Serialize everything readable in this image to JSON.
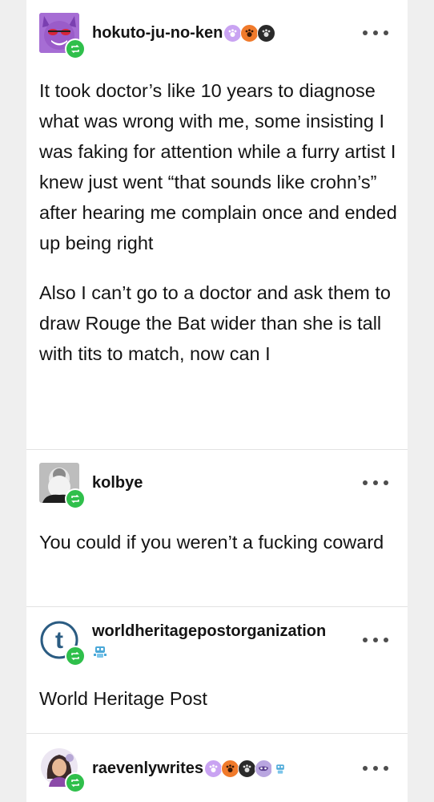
{
  "posts": [
    {
      "username": "hokuto-ju-no-ken",
      "badges": [
        "paw-badge-purple",
        "paw-badge-orange",
        "paw-badge-dark"
      ],
      "paragraphs": [
        "It took doctor’s like 10 years to diagnose what was wrong with me, some insisting I was faking for attention while a furry artist I knew just went “that sounds like crohn’s” after hearing me complain once and ended up being right",
        "Also I can’t go to a doctor and ask them to draw Rouge the Bat wider than she is tall with tits to match, now can I"
      ]
    },
    {
      "username": "kolbye",
      "badges": [],
      "paragraphs": [
        "You could if you weren’t a fucking coward"
      ]
    },
    {
      "username": "worldheritagepostorganization",
      "badges": [
        "robot-badge"
      ],
      "paragraphs": [
        "World Heritage Post"
      ]
    },
    {
      "username": "raevenlywrites",
      "badges": [
        "paw-badge-purple",
        "paw-badge-orange",
        "paw-badge-dark",
        "mask-badge",
        "robot-badge"
      ],
      "paragraphs": []
    }
  ],
  "colors": {
    "reblog_badge": "#2fbf4b",
    "tumblr_blue": "#2b5c82"
  }
}
